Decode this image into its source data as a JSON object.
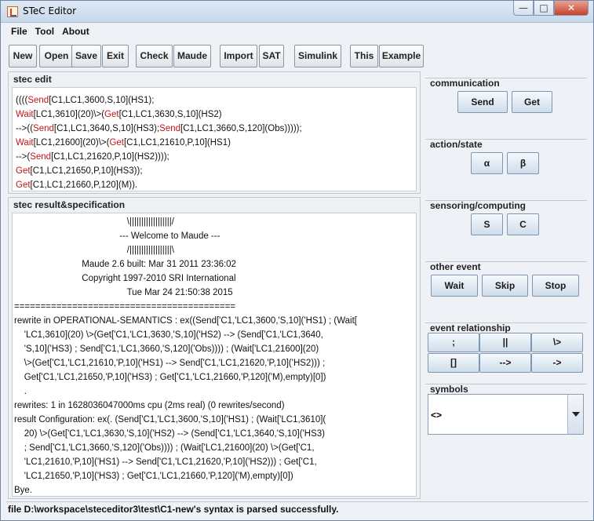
{
  "window": {
    "title": "STeC Editor"
  },
  "menu": {
    "file": "File",
    "tool": "Tool",
    "about": "About"
  },
  "toolbar": {
    "new": "New",
    "open": "Open",
    "save": "Save",
    "exit": "Exit",
    "check": "Check",
    "maude": "Maude",
    "import": "Import",
    "sat": "SAT",
    "simulink": "Simulink",
    "this": "This",
    "example": "Example"
  },
  "edit_panel": {
    "title": "stec edit",
    "lines": [
      [
        {
          "t": "(((("
        },
        {
          "t": "Send",
          "k": 1
        },
        {
          "t": "[C1,LC1,3600,S,10](HS1);"
        }
      ],
      [
        {
          "t": "Wait",
          "k": 1
        },
        {
          "t": "[LC1,3610](20)\\>("
        },
        {
          "t": "Get",
          "k": 1
        },
        {
          "t": "[C1,LC1,3630,S,10](HS2)"
        }
      ],
      [
        {
          "t": "-->(("
        },
        {
          "t": "Send",
          "k": 1
        },
        {
          "t": "[C1,LC1,3640,S,10](HS3);"
        },
        {
          "t": "Send",
          "k": 1
        },
        {
          "t": "[C1,LC1,3660,S,120](Obs)))));"
        }
      ],
      [
        {
          "t": "Wait",
          "k": 1
        },
        {
          "t": "[LC1,21600](20)\\>("
        },
        {
          "t": "Get",
          "k": 1
        },
        {
          "t": "[C1,LC1,21610,P,10](HS1)"
        }
      ],
      [
        {
          "t": "-->("
        },
        {
          "t": "Send",
          "k": 1
        },
        {
          "t": "[C1,LC1,21620,P,10](HS2))));"
        }
      ],
      [
        {
          "t": "Get",
          "k": 1
        },
        {
          "t": "[C1,LC1,21650,P,10](HS3));"
        }
      ],
      [
        {
          "t": "Get",
          "k": 1
        },
        {
          "t": "[C1,LC1,21660,P,120](M))."
        }
      ]
    ]
  },
  "result_panel": {
    "title": "stec result&specification",
    "lines": [
      "                                             \\||||||||||||||||||/",
      "                                          --- Welcome to Maude ---",
      "                                             /||||||||||||||||||\\",
      "                           Maude 2.6 built: Mar 31 2011 23:36:02",
      "                           Copyright 1997-2010 SRI International",
      "                                             Tue Mar 24 21:50:38 2015",
      "==========================================",
      "rewrite in OPERATIONAL-SEMANTICS : ex((Send['C1,'LC1,3600,'S,10]('HS1) ; (Wait[",
      "    'LC1,3610](20) \\>(Get['C1,'LC1,3630,'S,10]('HS2) --> (Send['C1,'LC1,3640,",
      "    'S,10]('HS3) ; Send['C1,'LC1,3660,'S,120]('Obs)))) ; (Wait['LC1,21600](20)",
      "    \\>(Get['C1,'LC1,21610,'P,10]('HS1) --> Send['C1,'LC1,21620,'P,10]('HS2))) ;",
      "    Get['C1,'LC1,21650,'P,10]('HS3) ; Get['C1,'LC1,21660,'P,120]('M),empty)[0])",
      "    .",
      "rewrites: 1 in 1628036047000ms cpu (2ms real) (0 rewrites/second)",
      "result Configuration: ex(. (Send['C1,'LC1,3600,'S,10]('HS1) ; (Wait['LC1,3610](",
      "    20) \\>(Get['C1,'LC1,3630,'S,10]('HS2) --> (Send['C1,'LC1,3640,'S,10]('HS3)",
      "    ; Send['C1,'LC1,3660,'S,120]('Obs)))) ; (Wait['LC1,21600](20) \\>(Get['C1,",
      "    'LC1,21610,'P,10]('HS1) --> Send['C1,'LC1,21620,'P,10]('HS2))) ; Get['C1,",
      "    'LC1,21650,'P,10]('HS3) ; Get['C1,'LC1,21660,'P,120]('M),empty)[0])",
      "Bye."
    ]
  },
  "communication": {
    "title": "communication",
    "send": "Send",
    "get": "Get"
  },
  "action_state": {
    "title": "action/state",
    "alpha": "α",
    "beta": "β"
  },
  "sensoring": {
    "title": "sensoring/computing",
    "s": "S",
    "c": "C"
  },
  "other_event": {
    "title": "other event",
    "wait": "Wait",
    "skip": "Skip",
    "stop": "Stop"
  },
  "event_relationship": {
    "title": "event relationship",
    "ops": [
      ";",
      "||",
      "\\>",
      "[]",
      "-->",
      "->"
    ]
  },
  "symbols": {
    "title": "symbols",
    "selected": "<>"
  },
  "status": {
    "text": "file D:\\workspace\\steceditor3\\test\\C1-new's syntax is  parsed successfully."
  }
}
